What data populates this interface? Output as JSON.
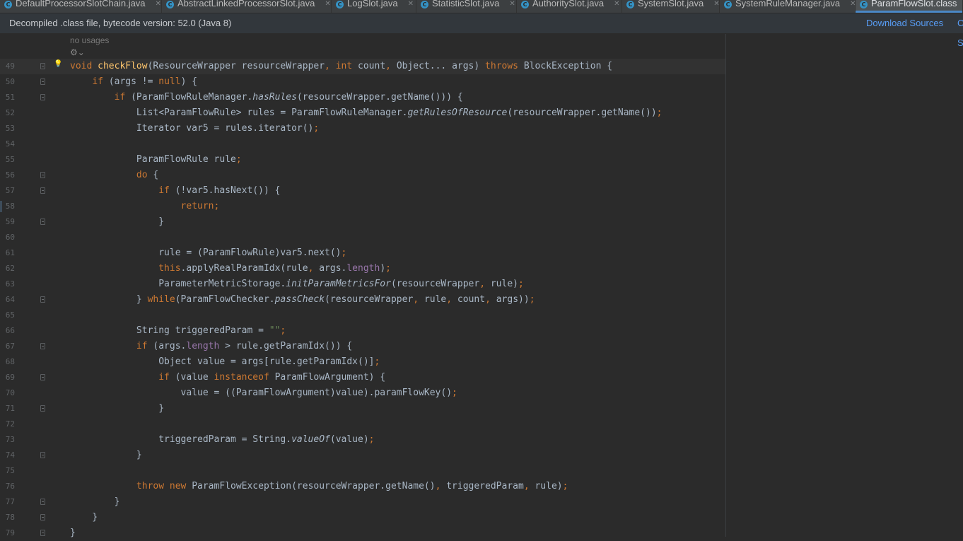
{
  "tabs": [
    {
      "label": "DefaultProcessorSlotChain.java",
      "active": false,
      "icon": "class-icon"
    },
    {
      "label": "AbstractLinkedProcessorSlot.java",
      "active": false,
      "icon": "class-icon"
    },
    {
      "label": "LogSlot.java",
      "active": false,
      "icon": "class-icon"
    },
    {
      "label": "StatisticSlot.java",
      "active": false,
      "icon": "class-icon"
    },
    {
      "label": "AuthoritySlot.java",
      "active": false,
      "icon": "class-icon"
    },
    {
      "label": "SystemSlot.java",
      "active": false,
      "icon": "class-icon"
    },
    {
      "label": "SystemRuleManager.java",
      "active": false,
      "icon": "class-icon"
    },
    {
      "label": "ParamFlowSlot.class",
      "active": true,
      "icon": "class-icon"
    }
  ],
  "banner": {
    "text": "Decompiled .class file, bytecode version: 52.0 (Java 8)",
    "download_sources": "Download Sources",
    "choose_sources": "Choose Sources..."
  },
  "editor": {
    "usages_hint": "no usages",
    "colors": {
      "keyword": "#cc7832",
      "method_decl": "#ffc66d",
      "field": "#9876aa",
      "string": "#6a8759",
      "default": "#a9b7c6",
      "background": "#2b2b2b"
    },
    "lines": [
      {
        "number": "49",
        "fold": true,
        "bulb": true,
        "current": true,
        "tokens": [
          {
            "t": "void ",
            "c": "k"
          },
          {
            "t": "checkFlow",
            "c": "f"
          },
          {
            "t": "(ResourceWrapper resourceWrapper"
          },
          {
            "t": ", ",
            "c": "pn"
          },
          {
            "t": "int ",
            "c": "k"
          },
          {
            "t": "count"
          },
          {
            "t": ", ",
            "c": "pn"
          },
          {
            "t": "Object... args) "
          },
          {
            "t": "throws ",
            "c": "k"
          },
          {
            "t": "BlockException {"
          }
        ]
      },
      {
        "number": "50",
        "fold": true,
        "tokens": [
          {
            "t": "    "
          },
          {
            "t": "if ",
            "c": "k"
          },
          {
            "t": "(args != "
          },
          {
            "t": "null",
            "c": "k"
          },
          {
            "t": ") {"
          }
        ]
      },
      {
        "number": "51",
        "fold": true,
        "tokens": [
          {
            "t": "        "
          },
          {
            "t": "if ",
            "c": "k"
          },
          {
            "t": "(ParamFlowRuleManager."
          },
          {
            "t": "hasRules",
            "c": "st"
          },
          {
            "t": "(resourceWrapper.getName())) {"
          }
        ]
      },
      {
        "number": "52",
        "fold": false,
        "tokens": [
          {
            "t": "            List<ParamFlowRule> rules = ParamFlowRuleManager."
          },
          {
            "t": "getRulesOfResource",
            "c": "st"
          },
          {
            "t": "(resourceWrapper.getName())"
          },
          {
            "t": ";",
            "c": "pn"
          }
        ]
      },
      {
        "number": "53",
        "fold": false,
        "tokens": [
          {
            "t": "            Iterator var5 = rules.iterator()"
          },
          {
            "t": ";",
            "c": "pn"
          }
        ]
      },
      {
        "number": "54",
        "fold": false,
        "tokens": []
      },
      {
        "number": "55",
        "fold": false,
        "tokens": [
          {
            "t": "            ParamFlowRule rule"
          },
          {
            "t": ";",
            "c": "pn"
          }
        ]
      },
      {
        "number": "56",
        "fold": true,
        "tokens": [
          {
            "t": "            "
          },
          {
            "t": "do ",
            "c": "k"
          },
          {
            "t": "{"
          }
        ]
      },
      {
        "number": "57",
        "fold": true,
        "tokens": [
          {
            "t": "                "
          },
          {
            "t": "if ",
            "c": "k"
          },
          {
            "t": "(!var5.hasNext()) {"
          }
        ]
      },
      {
        "number": "58",
        "fold": false,
        "marker": true,
        "tokens": [
          {
            "t": "                    "
          },
          {
            "t": "return;",
            "c": "k"
          }
        ]
      },
      {
        "number": "59",
        "fold": true,
        "tokens": [
          {
            "t": "                }"
          }
        ]
      },
      {
        "number": "60",
        "fold": false,
        "tokens": []
      },
      {
        "number": "61",
        "fold": false,
        "tokens": [
          {
            "t": "                rule = (ParamFlowRule)var5.next()"
          },
          {
            "t": ";",
            "c": "pn"
          }
        ]
      },
      {
        "number": "62",
        "fold": false,
        "tokens": [
          {
            "t": "                "
          },
          {
            "t": "this",
            "c": "k"
          },
          {
            "t": ".applyRealParamIdx(rule"
          },
          {
            "t": ", ",
            "c": "pn"
          },
          {
            "t": "args."
          },
          {
            "t": "length",
            "c": "fld"
          },
          {
            "t": ")"
          },
          {
            "t": ";",
            "c": "pn"
          }
        ]
      },
      {
        "number": "63",
        "fold": false,
        "tokens": [
          {
            "t": "                ParameterMetricStorage."
          },
          {
            "t": "initParamMetricsFor",
            "c": "st"
          },
          {
            "t": "(resourceWrapper"
          },
          {
            "t": ", ",
            "c": "pn"
          },
          {
            "t": "rule)"
          },
          {
            "t": ";",
            "c": "pn"
          }
        ]
      },
      {
        "number": "64",
        "fold": true,
        "tokens": [
          {
            "t": "            } "
          },
          {
            "t": "while",
            "c": "k"
          },
          {
            "t": "(ParamFlowChecker."
          },
          {
            "t": "passCheck",
            "c": "st"
          },
          {
            "t": "(resourceWrapper"
          },
          {
            "t": ", ",
            "c": "pn"
          },
          {
            "t": "rule"
          },
          {
            "t": ", ",
            "c": "pn"
          },
          {
            "t": "count"
          },
          {
            "t": ", ",
            "c": "pn"
          },
          {
            "t": "args))"
          },
          {
            "t": ";",
            "c": "pn"
          }
        ]
      },
      {
        "number": "65",
        "fold": false,
        "tokens": []
      },
      {
        "number": "66",
        "fold": false,
        "tokens": [
          {
            "t": "            String triggeredParam = "
          },
          {
            "t": "\"\"",
            "c": "str"
          },
          {
            "t": ";",
            "c": "pn"
          }
        ]
      },
      {
        "number": "67",
        "fold": true,
        "tokens": [
          {
            "t": "            "
          },
          {
            "t": "if ",
            "c": "k"
          },
          {
            "t": "(args."
          },
          {
            "t": "length",
            "c": "fld"
          },
          {
            "t": " > rule.getParamIdx()) {"
          }
        ]
      },
      {
        "number": "68",
        "fold": false,
        "tokens": [
          {
            "t": "                Object value = args[rule.getParamIdx()]"
          },
          {
            "t": ";",
            "c": "pn"
          }
        ]
      },
      {
        "number": "69",
        "fold": true,
        "tokens": [
          {
            "t": "                "
          },
          {
            "t": "if ",
            "c": "k"
          },
          {
            "t": "(value "
          },
          {
            "t": "instanceof ",
            "c": "k"
          },
          {
            "t": "ParamFlowArgument) {"
          }
        ]
      },
      {
        "number": "70",
        "fold": false,
        "tokens": [
          {
            "t": "                    value = ((ParamFlowArgument)value).paramFlowKey()"
          },
          {
            "t": ";",
            "c": "pn"
          }
        ]
      },
      {
        "number": "71",
        "fold": true,
        "tokens": [
          {
            "t": "                }"
          }
        ]
      },
      {
        "number": "72",
        "fold": false,
        "tokens": []
      },
      {
        "number": "73",
        "fold": false,
        "tokens": [
          {
            "t": "                triggeredParam = String."
          },
          {
            "t": "valueOf",
            "c": "st"
          },
          {
            "t": "(value)"
          },
          {
            "t": ";",
            "c": "pn"
          }
        ]
      },
      {
        "number": "74",
        "fold": true,
        "tokens": [
          {
            "t": "            }"
          }
        ]
      },
      {
        "number": "75",
        "fold": false,
        "tokens": []
      },
      {
        "number": "76",
        "fold": false,
        "tokens": [
          {
            "t": "            "
          },
          {
            "t": "throw new ",
            "c": "k"
          },
          {
            "t": "ParamFlowException(resourceWrapper.getName()"
          },
          {
            "t": ", ",
            "c": "pn"
          },
          {
            "t": "triggeredParam"
          },
          {
            "t": ", ",
            "c": "pn"
          },
          {
            "t": "rule)"
          },
          {
            "t": ";",
            "c": "pn"
          }
        ]
      },
      {
        "number": "77",
        "fold": true,
        "tokens": [
          {
            "t": "        }"
          }
        ]
      },
      {
        "number": "78",
        "fold": true,
        "tokens": [
          {
            "t": "    }"
          }
        ]
      },
      {
        "number": "79",
        "fold": true,
        "tokens": [
          {
            "t": "}"
          }
        ]
      }
    ]
  }
}
